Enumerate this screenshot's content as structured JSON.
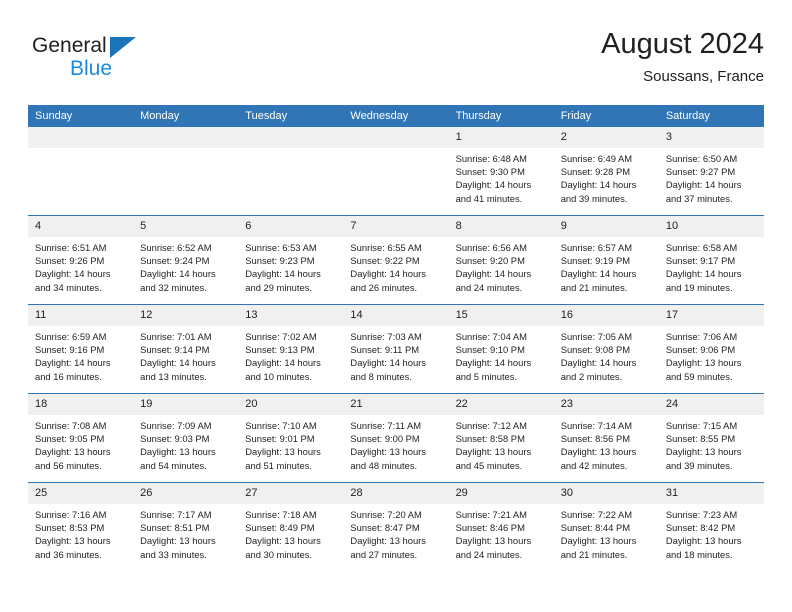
{
  "brand": {
    "name_part1": "General",
    "name_part2": "Blue",
    "triangle_color": "#1b75bb",
    "blue_text_color": "#1b8ae0"
  },
  "header": {
    "title": "August 2024",
    "subtitle": "Soussans, France"
  },
  "colors": {
    "header_blue": "#3075b6",
    "daynum_band": "#f0f0f0",
    "text": "#231f20"
  },
  "weekdays": [
    "Sunday",
    "Monday",
    "Tuesday",
    "Wednesday",
    "Thursday",
    "Friday",
    "Saturday"
  ],
  "labels": {
    "sunrise_prefix": "Sunrise:",
    "sunset_prefix": "Sunset:",
    "daylight_prefix": "Daylight:"
  },
  "weeks": [
    [
      {
        "day": "",
        "sunrise": "",
        "sunset": "",
        "daylight_line1": "",
        "daylight_line2": ""
      },
      {
        "day": "",
        "sunrise": "",
        "sunset": "",
        "daylight_line1": "",
        "daylight_line2": ""
      },
      {
        "day": "",
        "sunrise": "",
        "sunset": "",
        "daylight_line1": "",
        "daylight_line2": ""
      },
      {
        "day": "",
        "sunrise": "",
        "sunset": "",
        "daylight_line1": "",
        "daylight_line2": ""
      },
      {
        "day": "1",
        "sunrise": "Sunrise: 6:48 AM",
        "sunset": "Sunset: 9:30 PM",
        "daylight_line1": "Daylight: 14 hours",
        "daylight_line2": "and 41 minutes."
      },
      {
        "day": "2",
        "sunrise": "Sunrise: 6:49 AM",
        "sunset": "Sunset: 9:28 PM",
        "daylight_line1": "Daylight: 14 hours",
        "daylight_line2": "and 39 minutes."
      },
      {
        "day": "3",
        "sunrise": "Sunrise: 6:50 AM",
        "sunset": "Sunset: 9:27 PM",
        "daylight_line1": "Daylight: 14 hours",
        "daylight_line2": "and 37 minutes."
      }
    ],
    [
      {
        "day": "4",
        "sunrise": "Sunrise: 6:51 AM",
        "sunset": "Sunset: 9:26 PM",
        "daylight_line1": "Daylight: 14 hours",
        "daylight_line2": "and 34 minutes."
      },
      {
        "day": "5",
        "sunrise": "Sunrise: 6:52 AM",
        "sunset": "Sunset: 9:24 PM",
        "daylight_line1": "Daylight: 14 hours",
        "daylight_line2": "and 32 minutes."
      },
      {
        "day": "6",
        "sunrise": "Sunrise: 6:53 AM",
        "sunset": "Sunset: 9:23 PM",
        "daylight_line1": "Daylight: 14 hours",
        "daylight_line2": "and 29 minutes."
      },
      {
        "day": "7",
        "sunrise": "Sunrise: 6:55 AM",
        "sunset": "Sunset: 9:22 PM",
        "daylight_line1": "Daylight: 14 hours",
        "daylight_line2": "and 26 minutes."
      },
      {
        "day": "8",
        "sunrise": "Sunrise: 6:56 AM",
        "sunset": "Sunset: 9:20 PM",
        "daylight_line1": "Daylight: 14 hours",
        "daylight_line2": "and 24 minutes."
      },
      {
        "day": "9",
        "sunrise": "Sunrise: 6:57 AM",
        "sunset": "Sunset: 9:19 PM",
        "daylight_line1": "Daylight: 14 hours",
        "daylight_line2": "and 21 minutes."
      },
      {
        "day": "10",
        "sunrise": "Sunrise: 6:58 AM",
        "sunset": "Sunset: 9:17 PM",
        "daylight_line1": "Daylight: 14 hours",
        "daylight_line2": "and 19 minutes."
      }
    ],
    [
      {
        "day": "11",
        "sunrise": "Sunrise: 6:59 AM",
        "sunset": "Sunset: 9:16 PM",
        "daylight_line1": "Daylight: 14 hours",
        "daylight_line2": "and 16 minutes."
      },
      {
        "day": "12",
        "sunrise": "Sunrise: 7:01 AM",
        "sunset": "Sunset: 9:14 PM",
        "daylight_line1": "Daylight: 14 hours",
        "daylight_line2": "and 13 minutes."
      },
      {
        "day": "13",
        "sunrise": "Sunrise: 7:02 AM",
        "sunset": "Sunset: 9:13 PM",
        "daylight_line1": "Daylight: 14 hours",
        "daylight_line2": "and 10 minutes."
      },
      {
        "day": "14",
        "sunrise": "Sunrise: 7:03 AM",
        "sunset": "Sunset: 9:11 PM",
        "daylight_line1": "Daylight: 14 hours",
        "daylight_line2": "and 8 minutes."
      },
      {
        "day": "15",
        "sunrise": "Sunrise: 7:04 AM",
        "sunset": "Sunset: 9:10 PM",
        "daylight_line1": "Daylight: 14 hours",
        "daylight_line2": "and 5 minutes."
      },
      {
        "day": "16",
        "sunrise": "Sunrise: 7:05 AM",
        "sunset": "Sunset: 9:08 PM",
        "daylight_line1": "Daylight: 14 hours",
        "daylight_line2": "and 2 minutes."
      },
      {
        "day": "17",
        "sunrise": "Sunrise: 7:06 AM",
        "sunset": "Sunset: 9:06 PM",
        "daylight_line1": "Daylight: 13 hours",
        "daylight_line2": "and 59 minutes."
      }
    ],
    [
      {
        "day": "18",
        "sunrise": "Sunrise: 7:08 AM",
        "sunset": "Sunset: 9:05 PM",
        "daylight_line1": "Daylight: 13 hours",
        "daylight_line2": "and 56 minutes."
      },
      {
        "day": "19",
        "sunrise": "Sunrise: 7:09 AM",
        "sunset": "Sunset: 9:03 PM",
        "daylight_line1": "Daylight: 13 hours",
        "daylight_line2": "and 54 minutes."
      },
      {
        "day": "20",
        "sunrise": "Sunrise: 7:10 AM",
        "sunset": "Sunset: 9:01 PM",
        "daylight_line1": "Daylight: 13 hours",
        "daylight_line2": "and 51 minutes."
      },
      {
        "day": "21",
        "sunrise": "Sunrise: 7:11 AM",
        "sunset": "Sunset: 9:00 PM",
        "daylight_line1": "Daylight: 13 hours",
        "daylight_line2": "and 48 minutes."
      },
      {
        "day": "22",
        "sunrise": "Sunrise: 7:12 AM",
        "sunset": "Sunset: 8:58 PM",
        "daylight_line1": "Daylight: 13 hours",
        "daylight_line2": "and 45 minutes."
      },
      {
        "day": "23",
        "sunrise": "Sunrise: 7:14 AM",
        "sunset": "Sunset: 8:56 PM",
        "daylight_line1": "Daylight: 13 hours",
        "daylight_line2": "and 42 minutes."
      },
      {
        "day": "24",
        "sunrise": "Sunrise: 7:15 AM",
        "sunset": "Sunset: 8:55 PM",
        "daylight_line1": "Daylight: 13 hours",
        "daylight_line2": "and 39 minutes."
      }
    ],
    [
      {
        "day": "25",
        "sunrise": "Sunrise: 7:16 AM",
        "sunset": "Sunset: 8:53 PM",
        "daylight_line1": "Daylight: 13 hours",
        "daylight_line2": "and 36 minutes."
      },
      {
        "day": "26",
        "sunrise": "Sunrise: 7:17 AM",
        "sunset": "Sunset: 8:51 PM",
        "daylight_line1": "Daylight: 13 hours",
        "daylight_line2": "and 33 minutes."
      },
      {
        "day": "27",
        "sunrise": "Sunrise: 7:18 AM",
        "sunset": "Sunset: 8:49 PM",
        "daylight_line1": "Daylight: 13 hours",
        "daylight_line2": "and 30 minutes."
      },
      {
        "day": "28",
        "sunrise": "Sunrise: 7:20 AM",
        "sunset": "Sunset: 8:47 PM",
        "daylight_line1": "Daylight: 13 hours",
        "daylight_line2": "and 27 minutes."
      },
      {
        "day": "29",
        "sunrise": "Sunrise: 7:21 AM",
        "sunset": "Sunset: 8:46 PM",
        "daylight_line1": "Daylight: 13 hours",
        "daylight_line2": "and 24 minutes."
      },
      {
        "day": "30",
        "sunrise": "Sunrise: 7:22 AM",
        "sunset": "Sunset: 8:44 PM",
        "daylight_line1": "Daylight: 13 hours",
        "daylight_line2": "and 21 minutes."
      },
      {
        "day": "31",
        "sunrise": "Sunrise: 7:23 AM",
        "sunset": "Sunset: 8:42 PM",
        "daylight_line1": "Daylight: 13 hours",
        "daylight_line2": "and 18 minutes."
      }
    ]
  ]
}
